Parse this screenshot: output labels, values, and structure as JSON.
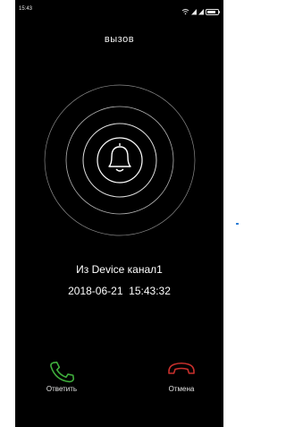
{
  "status_bar": {
    "time": "15:43",
    "icons": [
      "wifi-icon",
      "signal-icon",
      "signal-icon",
      "battery-icon"
    ]
  },
  "call": {
    "title": "вызов",
    "caller": "Из Device канал1",
    "datetime": "2018-06-21  15:43:32"
  },
  "actions": {
    "answer_label": "Ответить",
    "cancel_label": "Отмена"
  },
  "colors": {
    "background": "#000000",
    "answer": "#3fae3c",
    "cancel": "#c9302c",
    "ring": "#d8d8d8",
    "accent": "#2f7fd6"
  }
}
